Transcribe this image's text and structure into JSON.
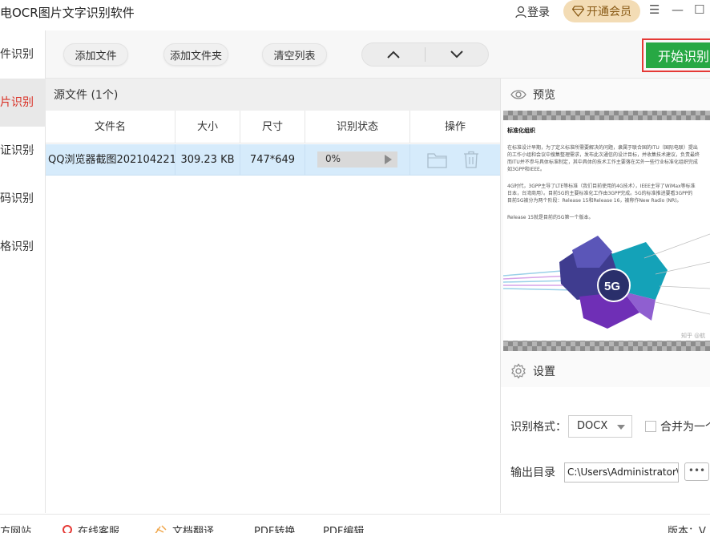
{
  "app": {
    "title": "电OCR图片文字识别软件",
    "login": "登录",
    "vip": "开通会员",
    "menu_glyph": "☰",
    "minimize_glyph": "—",
    "maximize_glyph": "☐"
  },
  "sidebar": {
    "items": [
      {
        "label": "件识别",
        "active": false
      },
      {
        "label": "片识别",
        "active": true
      },
      {
        "label": "证识别",
        "active": false,
        "chevron": "›"
      },
      {
        "label": "码识别",
        "active": false
      },
      {
        "label": "格识别",
        "active": false
      }
    ]
  },
  "toolbar": {
    "add_file": "添加文件",
    "add_folder": "添加文件夹",
    "clear_list": "清空列表",
    "start": "开始识别"
  },
  "files": {
    "header": "源文件 (1个)",
    "columns": [
      "文件名",
      "大小",
      "尺寸",
      "识别状态",
      "操作"
    ],
    "rows": [
      {
        "name": "QQ浏览器截图202104221...",
        "size": "309.23 KB",
        "dimensions": "747*649",
        "progress": 0,
        "progress_text": "0%"
      }
    ]
  },
  "preview": {
    "title": "预览",
    "doc": {
      "heading": "标准化组织",
      "paragraphs": [
        "在标准设计早期，为了定义标准所需要解决的问题，隶属于联合国的ITU（国际电联）提出",
        "的工作小组和会议中搜集整理需求，发布此次通信的设计目标，并收集技术建议，负责最终",
        "而ITU并不参与具体标准制定，其中具体的技术工作主要落在另外一些行业标准化组织完成",
        "如3GPP和IEEE。",
        "4G时代，3GPP主导了LTE等标准（我们目前使用的4G技术），IEEE主导了WiMax等标准",
        "日本，台湾商用）。目前5G的主要标准化工作由3GPP完成。5G的标准推进要看3GPP的",
        "目前5G被分为两个阶段：Release 15和Release 16，被称作New Radio (NR)。",
        "Release 15就是目前的5G第一个版本。"
      ],
      "watermark": "知乎 @航"
    }
  },
  "settings": {
    "title": "设置",
    "format_label": "识别格式：",
    "format_value": "DOCX",
    "merge_label": "合并为一个",
    "output_label": "输出目录",
    "output_value": "C:\\Users\\Administrator\\",
    "more": "•••"
  },
  "footer": {
    "website": "方网站",
    "service": "在线客服",
    "translate": "文档翻译",
    "pdf_convert": "PDF转换",
    "pdf_edit": "PDF编辑",
    "version": "版本：V"
  },
  "colors": {
    "accent_green": "#27a844",
    "highlight_red": "#e53935",
    "active_text": "#d93025",
    "selected_row": "#d6ebfb",
    "vip_bg": "#f3dcb5"
  }
}
